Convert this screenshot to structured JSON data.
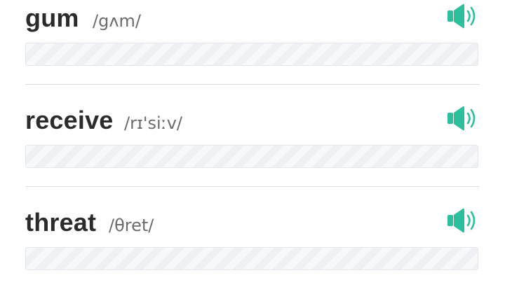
{
  "theme": {
    "accent_color": "#2bbf9c",
    "word_color": "#2b2b2b",
    "phonetic_color": "#6b6b6b"
  },
  "words": [
    {
      "word": "gum",
      "phonetic": "/gʌm/",
      "audio_icon": "speaker-icon",
      "answer_value": ""
    },
    {
      "word": "receive",
      "phonetic": "/rɪ'siːv/",
      "audio_icon": "speaker-icon",
      "answer_value": ""
    },
    {
      "word": "threat",
      "phonetic": "/θret/",
      "audio_icon": "speaker-icon",
      "answer_value": ""
    }
  ]
}
